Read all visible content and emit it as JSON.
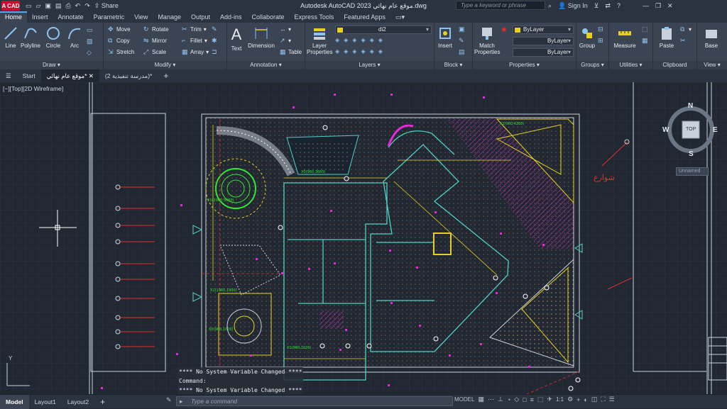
{
  "titlebar": {
    "app_badge": "A CAD",
    "title": "Autodesk AutoCAD 2023   موقع عام نهائي.dwg",
    "share": "Share",
    "search_placeholder": "Type a keyword or phrase",
    "sign_in": "Sign In"
  },
  "ribbon_tabs": [
    "Home",
    "Insert",
    "Annotate",
    "Parametric",
    "View",
    "Manage",
    "Output",
    "Add-ins",
    "Collaborate",
    "Express Tools",
    "Featured Apps"
  ],
  "ribbon": {
    "draw": {
      "title": "Draw",
      "line": "Line",
      "polyline": "Polyline",
      "circle": "Circle",
      "arc": "Arc"
    },
    "modify": {
      "title": "Modify",
      "move": "Move",
      "rotate": "Rotate",
      "trim": "Trim",
      "copy": "Copy",
      "mirror": "Mirror",
      "fillet": "Fillet",
      "stretch": "Stretch",
      "scale": "Scale",
      "array": "Array"
    },
    "annotation": {
      "title": "Annotation",
      "text": "Text",
      "dimension": "Dimension",
      "table": "Table"
    },
    "layers": {
      "title": "Layers",
      "layer_properties": "Layer Properties",
      "current_layer": "di2"
    },
    "block": {
      "title": "Block",
      "insert": "Insert"
    },
    "properties": {
      "title": "Properties",
      "match": "Match Properties",
      "color": "ByLayer",
      "linetype": "ByLayer",
      "lineweight": "ByLayer"
    },
    "groups": {
      "title": "Groups",
      "group": "Group"
    },
    "utilities": {
      "title": "Utilities",
      "measure": "Measure"
    },
    "clipboard": {
      "title": "Clipboard",
      "paste": "Paste"
    },
    "view": {
      "title": "View",
      "base": "Base"
    }
  },
  "doc_tabs": [
    "Start",
    "موقع عام نهائي*",
    "(مدرسة تنفيذية 2)*"
  ],
  "viewport_label": "[−][Top][2D Wireframe]",
  "viewcube": {
    "top": "TOP",
    "n": "N",
    "s": "S",
    "e": "E",
    "w": "W",
    "ucs": "Unnamed"
  },
  "drawing_text": {
    "street": "شوارع"
  },
  "command": {
    "line1": "**** No System Variable Changed ****",
    "line2": "Command:",
    "line3": "**** No System Variable Changed ****",
    "placeholder": "Type a command"
  },
  "layout_tabs": [
    "Model",
    "Layout1",
    "Layout2"
  ],
  "status": {
    "scale": "1:1",
    "model": "MODEL"
  },
  "colors": {
    "accent": "#5ba6e8",
    "line_cyan": "#4fd1c5",
    "green": "#33e633",
    "magenta": "#e32ad8",
    "yellow": "#e6d21e",
    "red": "#e03030"
  }
}
